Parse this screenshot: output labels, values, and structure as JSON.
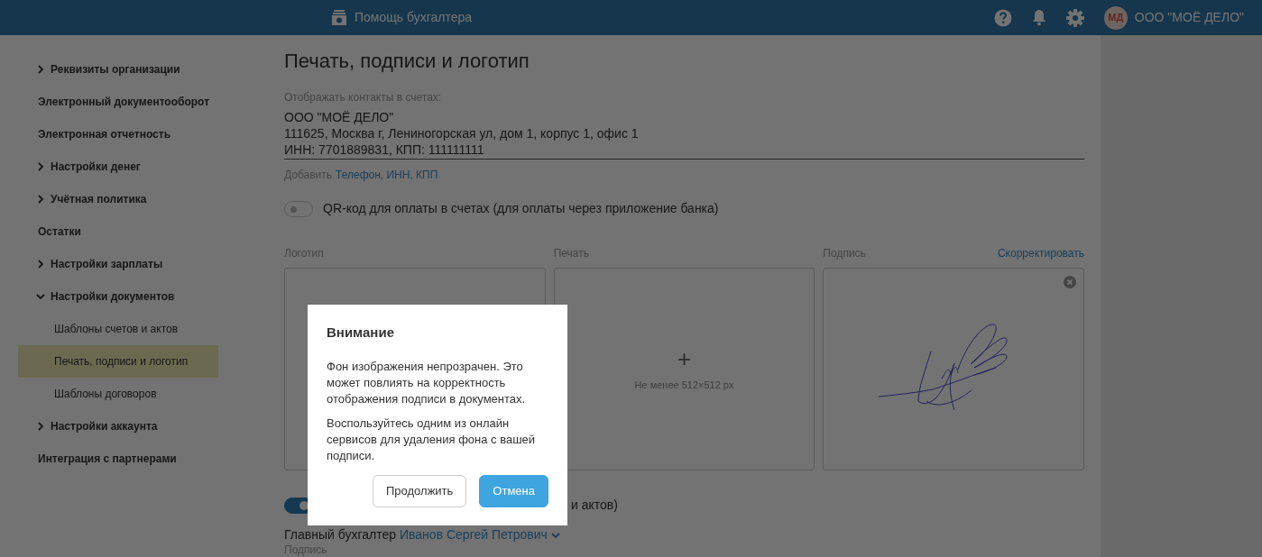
{
  "topbar": {
    "title": "Помощь бухгалтера",
    "avatar_initials": "МД",
    "company": "ООО \"МОЁ ДЕЛО\""
  },
  "sidebar": {
    "items": [
      {
        "label": "Реквизиты организации",
        "kind": "group",
        "expanded": false,
        "selected": false
      },
      {
        "label": "Электронный документооборот",
        "kind": "plain",
        "selected": false
      },
      {
        "label": "Электронная отчетность",
        "kind": "plain",
        "selected": false
      },
      {
        "label": "Настройки денег",
        "kind": "group",
        "expanded": false,
        "selected": false
      },
      {
        "label": "Учётная политика",
        "kind": "group",
        "expanded": false,
        "selected": false
      },
      {
        "label": "Остатки",
        "kind": "plain",
        "selected": false
      },
      {
        "label": "Настройки зарплаты",
        "kind": "group",
        "expanded": false,
        "selected": false
      },
      {
        "label": "Настройки документов",
        "kind": "group",
        "expanded": true,
        "selected": false,
        "children": [
          {
            "label": "Шаблоны счетов и актов",
            "selected": false
          },
          {
            "label": "Печать, подписи и логотип",
            "selected": true
          },
          {
            "label": "Шаблоны договоров",
            "selected": false
          }
        ]
      },
      {
        "label": "Настройки аккаунта",
        "kind": "group",
        "expanded": false,
        "selected": false
      },
      {
        "label": "Интеграция с партнерами",
        "kind": "plain",
        "selected": false
      }
    ]
  },
  "content": {
    "title": "Печать, подписи и логотип",
    "contacts_label": "Отображать контакты в счетах:",
    "contacts_lines": [
      "ООО \"МОЁ ДЕЛО\"",
      "111625, Москва г, Лениногорская ул, дом 1, корпус 1, офис 1",
      "ИНН: 7701889831, КПП: 111111111"
    ],
    "add_prefix": "Добавить",
    "add_link": "Телефон, ИНН, КПП",
    "qr_toggle": {
      "on": false,
      "label": "QR-код для оплаты в счетах (для оплаты через приложение банка)"
    },
    "panels": [
      {
        "label": "Логотип",
        "kind": "empty"
      },
      {
        "label": "Печать",
        "kind": "upload",
        "plus": "+",
        "hint": "Не менее 512×512 px"
      },
      {
        "label": "Подпись",
        "kind": "signature",
        "action": "Скорректировать"
      }
    ],
    "stamp_toggle": {
      "on": true,
      "label": "и актов)"
    },
    "accountant": {
      "label": "Главный бухгалтер",
      "name": "Иванов Сергей Петрович",
      "caption": "Подпись"
    }
  },
  "modal": {
    "title": "Внимание",
    "paragraphs": [
      "Фон изображения непрозрачен. Это может повлиять на корректность отображения подписи в документах.",
      "Воспользуйтесь одним из онлайн сервисов для удаления фона с вашей подписи."
    ],
    "buttons": [
      {
        "label": "Продолжить",
        "kind": "secondary"
      },
      {
        "label": "Отмена",
        "kind": "primary"
      }
    ]
  }
}
